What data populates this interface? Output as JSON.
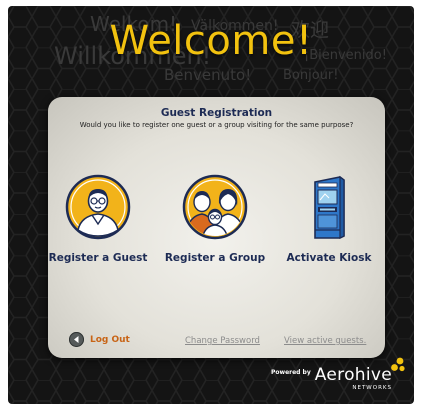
{
  "background_greetings": [
    {
      "text": "Welkom!"
    },
    {
      "text": "Välkommen!"
    },
    {
      "text": "欢迎"
    },
    {
      "text": "Willkommen!"
    },
    {
      "text": "Benvenuto!"
    },
    {
      "text": "Bonjour!"
    },
    {
      "text": "¡Bienvenido!"
    }
  ],
  "header": {
    "title": "Welcome!"
  },
  "panel": {
    "title": "Guest Registration",
    "subtitle": "Would you like to register one guest or a group visiting for the same purpose?",
    "options": [
      {
        "label": "Register a Guest",
        "icon": "single-guest-icon"
      },
      {
        "label": "Register a Group",
        "icon": "group-guests-icon"
      },
      {
        "label": "Activate Kiosk",
        "icon": "kiosk-icon"
      }
    ],
    "footer": {
      "logout_label": "Log Out",
      "change_password_label": "Change Password",
      "view_guests_label": "View active guests."
    }
  },
  "branding": {
    "powered_by": "Powered by",
    "name": "Aerohive",
    "sub": "NETWORKS"
  },
  "colors": {
    "accent_yellow": "#f2c20f",
    "navy": "#1d2b54",
    "logout_orange": "#c86416",
    "panel_bg": "#e6e4dc",
    "background": "#141414"
  }
}
